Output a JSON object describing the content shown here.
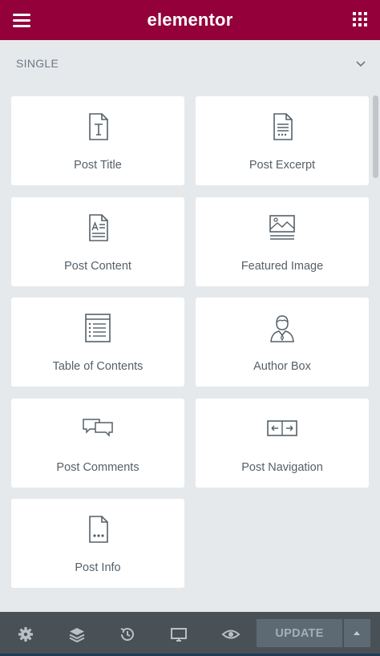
{
  "app": {
    "logo_text": "elementor",
    "brand_color": "#93003a",
    "menu_icon": "hamburger-menu-icon",
    "apps_icon": "apps-grid-icon"
  },
  "section": {
    "title": "SINGLE",
    "toggle_icon": "chevron-down-icon"
  },
  "widgets": [
    {
      "label": "Post Title",
      "icon": "post-title-icon"
    },
    {
      "label": "Post Excerpt",
      "icon": "post-excerpt-icon"
    },
    {
      "label": "Post Content",
      "icon": "post-content-icon"
    },
    {
      "label": "Featured Image",
      "icon": "featured-image-icon"
    },
    {
      "label": "Table of Contents",
      "icon": "table-of-contents-icon"
    },
    {
      "label": "Author Box",
      "icon": "author-box-icon"
    },
    {
      "label": "Post Comments",
      "icon": "post-comments-icon"
    },
    {
      "label": "Post Navigation",
      "icon": "post-navigation-icon"
    },
    {
      "label": "Post Info",
      "icon": "post-info-icon"
    }
  ],
  "footer": {
    "buttons": [
      "settings-icon",
      "navigator-layers-icon",
      "history-icon",
      "responsive-mode-icon",
      "preview-eye-icon"
    ],
    "update_label": "UPDATE",
    "update_options_icon": "caret-up-icon"
  }
}
